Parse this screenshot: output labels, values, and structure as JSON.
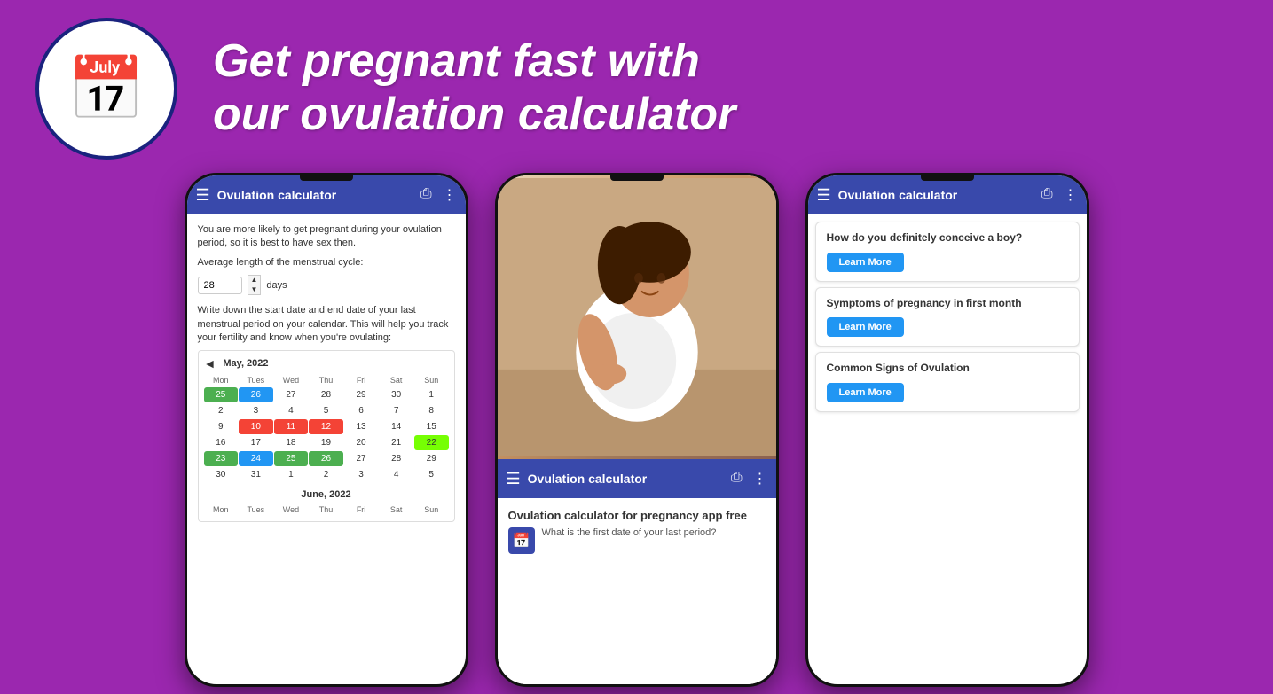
{
  "header": {
    "title_line1": "Get pregnant fast with",
    "title_line2": "our ovulation calculator",
    "logo_emoji": "📅"
  },
  "app_bar": {
    "title": "Ovulation calculator",
    "menu_icon": "☰",
    "share_icon": "⎙",
    "dots_icon": "⋮"
  },
  "phone1": {
    "text1": "You are more likely to get pregnant during your ovulation period, so it is best to have sex then.",
    "text2": "Average length of the menstrual cycle:",
    "cycle_value": "28",
    "cycle_unit": "days",
    "text3": "Write down the start date and end date of your last menstrual period on your calendar. This will help you track your fertility and know when you're ovulating:",
    "calendar1": {
      "nav": "◄",
      "month": "May, 2022",
      "days_of_week": [
        "Mon",
        "Tues",
        "Wed",
        "Thu",
        "Fri",
        "Sat",
        "Sun"
      ],
      "rows": [
        [
          {
            "n": "25",
            "c": "green"
          },
          {
            "n": "26",
            "c": "blue"
          },
          {
            "n": "27",
            "c": ""
          },
          {
            "n": "28",
            "c": ""
          },
          {
            "n": "29",
            "c": ""
          },
          {
            "n": "30",
            "c": ""
          },
          {
            "n": "1",
            "c": ""
          }
        ],
        [
          {
            "n": "2",
            "c": ""
          },
          {
            "n": "3",
            "c": ""
          },
          {
            "n": "4",
            "c": ""
          },
          {
            "n": "5",
            "c": ""
          },
          {
            "n": "6",
            "c": ""
          },
          {
            "n": "7",
            "c": ""
          },
          {
            "n": "8",
            "c": ""
          }
        ],
        [
          {
            "n": "9",
            "c": ""
          },
          {
            "n": "10",
            "c": "red"
          },
          {
            "n": "11",
            "c": "red"
          },
          {
            "n": "12",
            "c": "red"
          },
          {
            "n": "13",
            "c": ""
          },
          {
            "n": "14",
            "c": ""
          },
          {
            "n": "15",
            "c": ""
          }
        ],
        [
          {
            "n": "16",
            "c": ""
          },
          {
            "n": "17",
            "c": ""
          },
          {
            "n": "18",
            "c": ""
          },
          {
            "n": "19",
            "c": ""
          },
          {
            "n": "20",
            "c": ""
          },
          {
            "n": "21",
            "c": ""
          },
          {
            "n": "22",
            "c": "bright-green"
          }
        ],
        [
          {
            "n": "23",
            "c": "green"
          },
          {
            "n": "24",
            "c": "blue"
          },
          {
            "n": "25",
            "c": "green"
          },
          {
            "n": "26",
            "c": "green"
          },
          {
            "n": "27",
            "c": ""
          },
          {
            "n": "28",
            "c": ""
          },
          {
            "n": "29",
            "c": ""
          }
        ],
        [
          {
            "n": "30",
            "c": ""
          },
          {
            "n": "31",
            "c": ""
          },
          {
            "n": "1",
            "c": ""
          },
          {
            "n": "2",
            "c": ""
          },
          {
            "n": "3",
            "c": ""
          },
          {
            "n": "4",
            "c": ""
          },
          {
            "n": "5",
            "c": ""
          }
        ]
      ]
    },
    "calendar2_month": "June, 2022",
    "calendar2_dow": [
      "Mon",
      "Tues",
      "Wed",
      "Thu",
      "Fri",
      "Sun"
    ]
  },
  "phone2": {
    "bottom_title": "Ovulation calculator for pregnancy app free",
    "bottom_text": "What is the first date of your last period?"
  },
  "phone3": {
    "cards": [
      {
        "title": "How do you definitely conceive a boy?",
        "btn_label": "Learn More"
      },
      {
        "title": "Symptoms of pregnancy in first month",
        "btn_label": "Learn More"
      },
      {
        "title": "Common Signs of Ovulation",
        "btn_label": "Learn More"
      }
    ]
  }
}
